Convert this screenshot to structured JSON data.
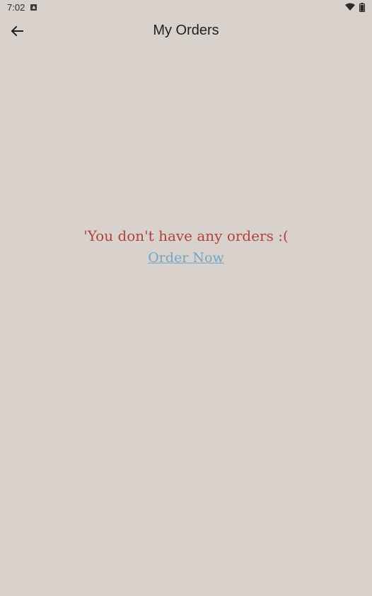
{
  "status_bar": {
    "time": "7:02",
    "icons": [
      "notification-icon",
      "wifi-icon",
      "battery-icon"
    ]
  },
  "app_bar": {
    "title": "My Orders",
    "back_icon": "arrow-left-icon"
  },
  "empty_state": {
    "message": "'You don't have any orders :(",
    "action_label": "Order Now"
  },
  "colors": {
    "background": "#d9d2cc",
    "message": "#b3413b",
    "link": "#6fa6c7"
  }
}
